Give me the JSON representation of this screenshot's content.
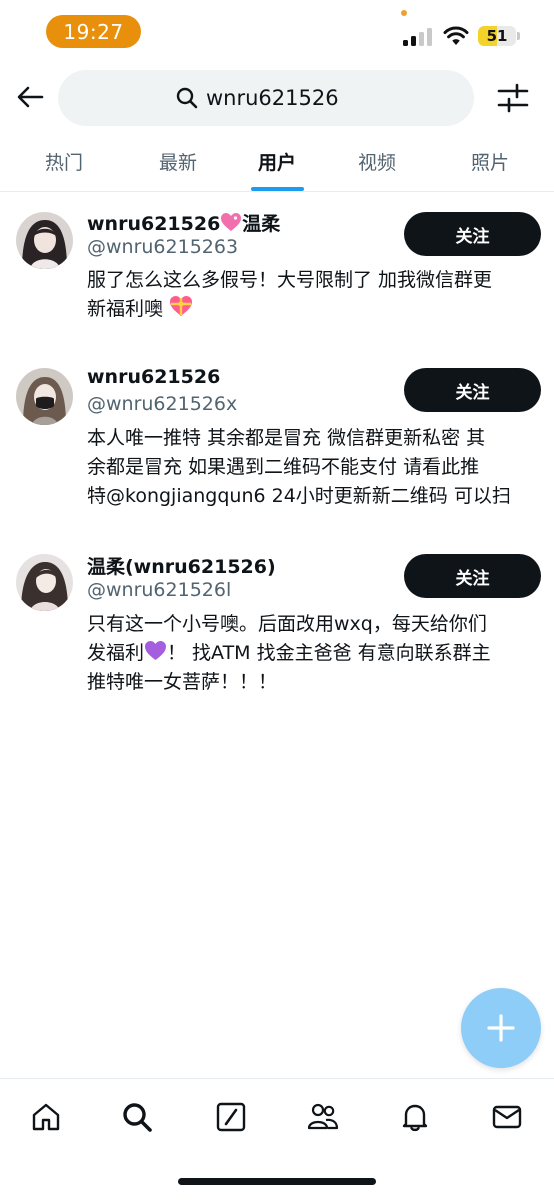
{
  "status_bar": {
    "time": "19:27",
    "battery": "51",
    "battery_level": 0.51
  },
  "search": {
    "query": "wnru621526",
    "icons": [
      "back-arrow-icon",
      "search-icon",
      "filter-sliders-icon"
    ]
  },
  "tabs": [
    {
      "label": "热门",
      "active": false
    },
    {
      "label": "最新",
      "active": false
    },
    {
      "label": "用户",
      "active": true
    },
    {
      "label": "视频",
      "active": false
    },
    {
      "label": "照片",
      "active": false
    }
  ],
  "users": [
    {
      "name": "wnru621526",
      "name_suffix": "温柔",
      "name_emoji": "sparkling-heart",
      "handle": "@wnru6215263",
      "bio_lines": [
        "服了怎么这么多假号！大号限制了 加我微信群更",
        "新福利噢"
      ],
      "bio_emoji": "heart-with-ribbon",
      "follow_label": "关注"
    },
    {
      "name": "wnru621526",
      "handle": "@wnru621526x",
      "bio_lines": [
        "本人唯一推特 其余都是冒充 微信群更新私密 其",
        "余都是冒充 如果遇到二维码不能支付 请看此推",
        "特@kongjiangqun6 24小时更新新二维码 可以扫"
      ],
      "follow_label": "关注"
    },
    {
      "name": "温柔(wnru621526)",
      "handle": "@wnru621526l",
      "bio_lines": [
        "只有这一个小号噢。后面改用wxq，每天给你们",
        "发福利",
        "！ 找ATM 找金主爸爸 有意向联系群主",
        "推特唯一女菩萨！！！"
      ],
      "bio_emoji": "purple-heart",
      "follow_label": "关注"
    }
  ],
  "fab": {
    "icon": "plus-icon",
    "color": "#8ecdf8"
  },
  "bottom_nav": [
    "home-icon",
    "search-icon",
    "grok-icon",
    "communities-icon",
    "notifications-bell-icon",
    "messages-envelope-icon"
  ],
  "colors": {
    "accent": "#1d9bf0",
    "follow_button": "#0f1419",
    "time_pill": "#e8900c",
    "battery_fill": "#f3d32a"
  }
}
